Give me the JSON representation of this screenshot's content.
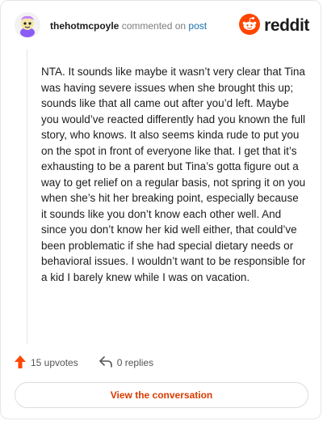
{
  "comment": {
    "username": "thehotmcpoyle",
    "action_text": "commented on",
    "post_link": "post",
    "body": "NTA. It sounds like maybe it wasn’t very clear that Tina was having severe issues when she brought this up; sounds like that all came out after you’d left. Maybe you would’ve reacted differently had you known the full story, who knows. It also seems kinda rude to put you on the spot in front of everyone like that. I get that it’s exhausting to be a parent but Tina’s gotta figure out a way to get relief on a regular basis, not spring it on you when she’s hit her breaking point, especially because it sounds like you don’t know each other well. And since you don’t know her kid well either, that could’ve been problematic if she had special dietary needs or behavioral issues. I wouldn’t want to be responsible for a kid I barely knew while I was on vacation.",
    "upvotes_label": "15 upvotes",
    "replies_label": "0 replies"
  },
  "brand": {
    "name": "reddit",
    "icon": "reddit-snoo-icon",
    "color": "#ff4500"
  },
  "cta": {
    "label": "View the conversation"
  },
  "icons": {
    "upvote": "upvote-arrow-icon",
    "reply": "reply-arrow-icon",
    "avatar": "avatar"
  },
  "colors": {
    "accent": "#ff4500",
    "link": "#1a6fb0",
    "cta_text": "#d93a00"
  }
}
